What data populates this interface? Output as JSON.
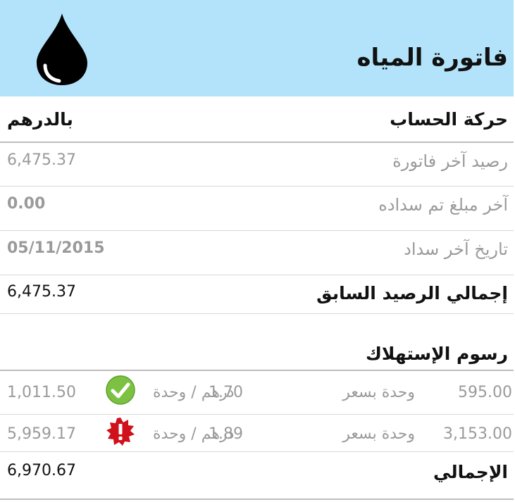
{
  "header": {
    "title": "فاتورة المياه",
    "icon": "water-drop-icon",
    "background": "#b3e3fb"
  },
  "account": {
    "heading": "حركة الحساب",
    "currency": "بالدرهم",
    "rows": [
      {
        "label": "رصيد آخر فاتورة",
        "value": "6,475.37"
      },
      {
        "label": "آخر مبلغ تم سداده",
        "value": "0.00"
      },
      {
        "label": "تاريخ آخر سداد",
        "value": "05/11/2015"
      }
    ],
    "total_label": "إجمالي الرصيد السابق",
    "total_value": "6,475.37"
  },
  "consumption": {
    "heading": "رسوم الإستهلاك",
    "tiers": [
      {
        "units": "595.00",
        "rate_label": "وحدة بسعر",
        "rate": "1.70",
        "unit_label": "درهم / وحدة",
        "status_icon": "check-icon",
        "amount": "1,011.50"
      },
      {
        "units": "3,153.00",
        "rate_label": "وحدة بسعر",
        "rate": "1.89",
        "unit_label": "درهم / وحدة",
        "status_icon": "alert-badge-icon",
        "amount": "5,959.17"
      }
    ],
    "total_label": "الإجمالي",
    "total_value": "6,970.67"
  },
  "colors": {
    "check": "#7cc142",
    "alert": "#d0101b"
  }
}
